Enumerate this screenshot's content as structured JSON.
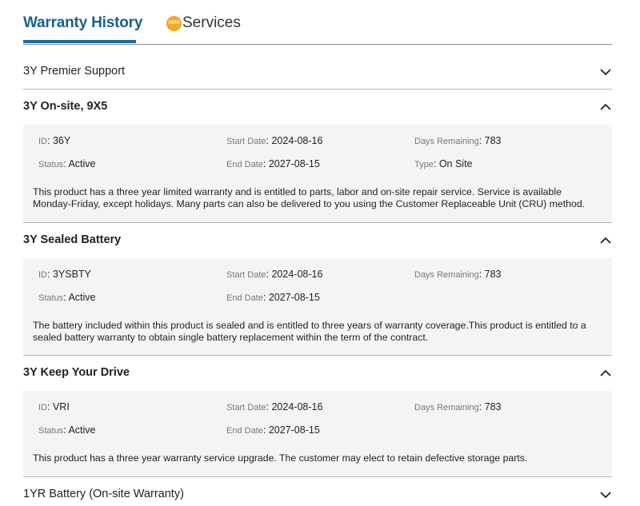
{
  "tabs": {
    "warranty_history": "Warranty History",
    "services": "Services",
    "new_badge": "NEW"
  },
  "labels": {
    "id": "ID",
    "start_date": "Start Date",
    "days_remaining": "Days Remaining",
    "status": "Status",
    "end_date": "End Date",
    "type": "Type"
  },
  "sections": [
    {
      "title": "3Y Premier Support",
      "expanded": false
    },
    {
      "title": "3Y On-site, 9X5",
      "expanded": true,
      "id": "36Y",
      "start_date": "2024-08-16",
      "days_remaining": "783",
      "status": "Active",
      "end_date": "2027-08-15",
      "type": "On Site",
      "description": "This product has a three year limited warranty and is entitled to parts, labor and on-site repair service. Service is available Monday-Friday, except holidays. Many parts can also be delivered to you using the Customer Replaceable Unit (CRU) method."
    },
    {
      "title": "3Y Sealed Battery",
      "expanded": true,
      "id": "3YSBTY",
      "start_date": "2024-08-16",
      "days_remaining": "783",
      "status": "Active",
      "end_date": "2027-08-15",
      "description": "The battery included within this product is sealed and is entitled to three years of warranty coverage.This product is entitled to a sealed battery warranty to obtain single battery replacement within the term of the contract."
    },
    {
      "title": "3Y Keep Your Drive",
      "expanded": true,
      "id": "VRI",
      "start_date": "2024-08-16",
      "days_remaining": "783",
      "status": "Active",
      "end_date": "2027-08-15",
      "description": "This product has a three year warranty service upgrade. The customer may elect to retain defective storage parts."
    },
    {
      "title": "1YR Battery (On-site Warranty)",
      "expanded": false
    }
  ],
  "colors": {
    "tab_active": "#1a5f8f",
    "underline": "#1a6b99",
    "badge": "#f5a623",
    "panel_bg": "#f4f4f4"
  }
}
